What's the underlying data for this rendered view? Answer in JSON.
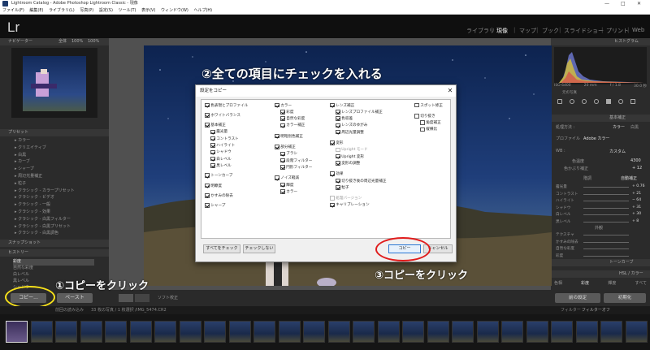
{
  "window": {
    "title": "Lightroom Catalog - Adobe Photoshop Lightroom Classic - 現像",
    "menu": [
      "ファイル(F)",
      "編集(E)",
      "ライブラリ(L)",
      "写真(P)",
      "設定(S)",
      "ツール(T)",
      "表示(V)",
      "ウィンドウ(W)",
      "ヘルプ(H)"
    ],
    "controls": {
      "min": "—",
      "max": "□",
      "close": "✕"
    }
  },
  "app": {
    "logo": "Lr",
    "modules": [
      "ライブラリ",
      "現像",
      "マップ",
      "ブック",
      "スライドショー",
      "プリント",
      "Web"
    ],
    "active_module": "現像"
  },
  "left_panel": {
    "navigator": {
      "header": "ナビゲーター",
      "fit": "全体",
      "fill": "100%",
      "ratio": "100%"
    },
    "presets": {
      "header": "プリセット",
      "items": [
        "カラー",
        "クリエイティブ",
        "白黒",
        "カーブ",
        "シャープ",
        "周辺光量補正",
        "粒子",
        "クラシック - カラープリセット",
        "クラシック - ビデオ",
        "クラシック - 一般",
        "クラシック - 効果",
        "クラシック - 白黒フィルター",
        "クラシック - 白黒プリセット",
        "クラシック - 白黒調色"
      ]
    },
    "snapshots": {
      "header": "スナップショット"
    },
    "history": {
      "header": "ヒストリー",
      "items": [
        "彩度",
        "自然な彩度",
        "白レベル",
        "黒レベル",
        "シャドウ"
      ],
      "value": "+1"
    },
    "copy_button": "コピー...",
    "paste_button": "ペースト"
  },
  "right_panel": {
    "histogram_header": "ヒストグラム",
    "iso_info": [
      "ISO 6400",
      "20 mm",
      "f / 1.8",
      "30.0 秒"
    ],
    "original_photo": "元の写真",
    "basic": {
      "header": "基本補正",
      "treatment": [
        "カラー",
        "白黒"
      ],
      "profile_label": "プロファイル",
      "profile_value": "Adobe カラー",
      "wb_label": "WB :",
      "wb_value": "カスタム",
      "temp_label": "色温度",
      "temp_value": "4300",
      "tint_label": "色かぶり補正",
      "tint_value": "+ 12",
      "tone_label": "階調",
      "auto_label": "自動補正",
      "sliders": [
        {
          "label": "露光量",
          "value": "+ 0.76"
        },
        {
          "label": "コントラスト",
          "value": "+ 21"
        },
        {
          "label": "ハイライト",
          "value": "− 64"
        },
        {
          "label": "シャドウ",
          "value": "+ 31"
        },
        {
          "label": "白レベル",
          "value": "+ 30"
        },
        {
          "label": "黒レベル",
          "value": "+ 8"
        }
      ],
      "presence_label": "外観",
      "presence": [
        "テクスチャ",
        "かすみの除去",
        "自然な彩度",
        "彩度"
      ]
    },
    "tone_curve": "トーンカーブ",
    "hsl": {
      "header": "HSL / カラー",
      "tabs": [
        "色相",
        "彩度",
        "輝度",
        "すべて"
      ]
    },
    "prev_button": "前の設定",
    "reset_button": "初期化"
  },
  "toolbar": {
    "soft_proof": "ソフト校正",
    "filter_label": "フィルター :",
    "filter_value": "フィルターオフ"
  },
  "filmstrip": {
    "info": "前回の読み込み",
    "count": "33 枚の写真 / 1 枚選択 /",
    "filename": "IMG_5474.CR2"
  },
  "dialog": {
    "title": "設定をコピー",
    "close": "✕",
    "columns": [
      [
        {
          "label": "色表現とプロファイル",
          "checked": true,
          "indent": 0
        },
        {
          "label": "ホワイトバランス",
          "checked": true,
          "indent": 0
        },
        {
          "label": "基本補正",
          "checked": true,
          "indent": 0
        },
        {
          "label": "露光量",
          "checked": true,
          "indent": 1
        },
        {
          "label": "コントラスト",
          "checked": true,
          "indent": 1
        },
        {
          "label": "ハイライト",
          "checked": true,
          "indent": 1
        },
        {
          "label": "シャドウ",
          "checked": true,
          "indent": 1
        },
        {
          "label": "白レベル",
          "checked": true,
          "indent": 1
        },
        {
          "label": "黒レベル",
          "checked": true,
          "indent": 1
        },
        {
          "label": "トーンカーブ",
          "checked": true,
          "indent": 0
        },
        {
          "label": "明瞭度",
          "checked": true,
          "indent": 0
        },
        {
          "label": "かすみの除去",
          "checked": true,
          "indent": 0
        },
        {
          "label": "シャープ",
          "checked": true,
          "indent": 0
        }
      ],
      [
        {
          "label": "カラー",
          "checked": true,
          "indent": 0
        },
        {
          "label": "彩度",
          "checked": true,
          "indent": 1
        },
        {
          "label": "自然な彩度",
          "checked": true,
          "indent": 1
        },
        {
          "label": "カラー補正",
          "checked": true,
          "indent": 1
        },
        {
          "label": "明暗別色補正",
          "checked": true,
          "indent": 0
        },
        {
          "label": "部分補正",
          "checked": true,
          "indent": 0
        },
        {
          "label": "ブラシ",
          "checked": true,
          "indent": 1
        },
        {
          "label": "段階フィルター",
          "checked": true,
          "indent": 1
        },
        {
          "label": "円形フィルター",
          "checked": true,
          "indent": 1
        },
        {
          "label": "ノイズ軽減",
          "checked": true,
          "indent": 0
        },
        {
          "label": "輝度",
          "checked": true,
          "indent": 1
        },
        {
          "label": "カラー",
          "checked": true,
          "indent": 1
        }
      ],
      [
        {
          "label": "レンズ補正",
          "checked": true,
          "indent": 0
        },
        {
          "label": "レンズプロファイル補正",
          "checked": true,
          "indent": 1
        },
        {
          "label": "色収差",
          "checked": true,
          "indent": 1
        },
        {
          "label": "レンズのゆがみ",
          "checked": true,
          "indent": 1
        },
        {
          "label": "周辺光量調整",
          "checked": true,
          "indent": 1
        },
        {
          "label": "変形",
          "checked": true,
          "indent": 0
        },
        {
          "label": "Upright モード",
          "checked": false,
          "indent": 1,
          "disabled": true
        },
        {
          "label": "Upright 変形",
          "checked": true,
          "indent": 1
        },
        {
          "label": "変形の調整",
          "checked": true,
          "indent": 1
        },
        {
          "label": "効果",
          "checked": true,
          "indent": 0
        },
        {
          "label": "切り抜き後の周辺光量補正",
          "checked": true,
          "indent": 1
        },
        {
          "label": "粒子",
          "checked": true,
          "indent": 1
        },
        {
          "label": "処理バージョン",
          "checked": false,
          "indent": 0,
          "disabled": true
        },
        {
          "label": "キャリブレーション",
          "checked": true,
          "indent": 0
        }
      ],
      [
        {
          "label": "スポット修正",
          "checked": false,
          "indent": 0
        },
        {
          "label": "切り抜き",
          "checked": false,
          "indent": 0
        },
        {
          "label": "角度補正",
          "checked": false,
          "indent": 1
        },
        {
          "label": "縦横比",
          "checked": false,
          "indent": 1
        }
      ]
    ],
    "check_all": "すべてをチェック",
    "check_none": "チェックしない",
    "copy": "コピー",
    "cancel": "キャンセル"
  },
  "annotations": {
    "step1": "①コピーをクリック",
    "step2": "②全ての項目にチェックを入れる",
    "step3": "③コピーをクリック",
    "highlight_yellow": "#f7e11a",
    "highlight_red": "#e01c1c"
  }
}
